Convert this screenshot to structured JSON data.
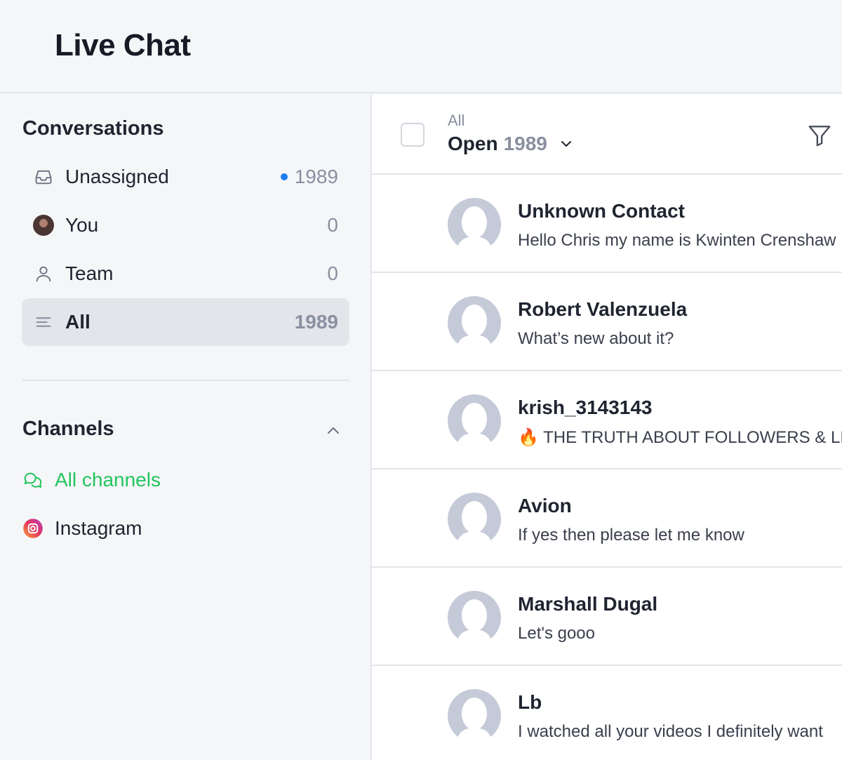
{
  "app": {
    "title": "Live Chat"
  },
  "sidebar": {
    "conversations_heading": "Conversations",
    "items": [
      {
        "label": "Unassigned",
        "count": "1989",
        "icon": "inbox-icon",
        "unread": true
      },
      {
        "label": "You",
        "count": "0",
        "icon": "user-avatar"
      },
      {
        "label": "Team",
        "count": "0",
        "icon": "person-icon"
      },
      {
        "label": "All",
        "count": "1989",
        "icon": "list-icon",
        "active": true
      }
    ],
    "channels_heading": "Channels",
    "channels": [
      {
        "label": "All channels",
        "icon": "chat-bubbles-icon",
        "selected": true
      },
      {
        "label": "Instagram",
        "icon": "instagram-icon"
      }
    ]
  },
  "list": {
    "filter_caption": "All",
    "status_label": "Open",
    "status_count": "1989",
    "conversations": [
      {
        "name": "Unknown Contact",
        "preview": "Hello Chris my name is Kwinten Crenshaw"
      },
      {
        "name": "Robert Valenzuela",
        "preview": "What’s new about it?"
      },
      {
        "name": "krish_3143143",
        "preview": "🔥 THE TRUTH ABOUT FOLLOWERS & LIKES"
      },
      {
        "name": "Avion",
        "preview": "If yes then please let me know"
      },
      {
        "name": "Marshall Dugal",
        "preview": "Let's gooo"
      },
      {
        "name": "Lb",
        "preview": "I watched all your videos I definitely want"
      }
    ]
  },
  "colors": {
    "accent_green": "#22c55e",
    "unread_dot": "#1a7ef2",
    "active_bg": "#e3e5ea",
    "avatar_placeholder": "#c5cad8"
  }
}
